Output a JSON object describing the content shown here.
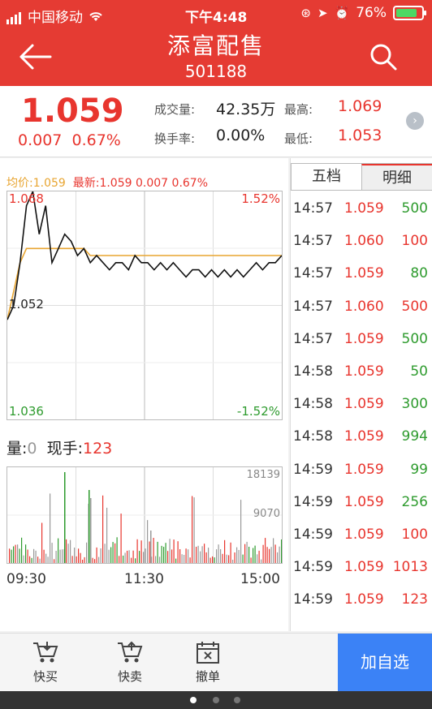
{
  "status": {
    "carrier": "中国移动",
    "time": "下午4:48",
    "battery": "76%"
  },
  "header": {
    "title": "添富配售",
    "code": "501188"
  },
  "quote": {
    "price": "1.059",
    "change": "0.007",
    "change_pct": "0.67%",
    "volume_label": "成交量:",
    "volume": "42.35万",
    "turnover_label": "换手率:",
    "turnover": "0.00%",
    "high_label": "最高:",
    "high": "1.069",
    "low_label": "最低:",
    "low": "1.053"
  },
  "chart_legend": {
    "avg_label": "均价:",
    "avg": "1.059",
    "latest_label": "最新:",
    "latest": "1.059",
    "change": "0.007",
    "change_pct": "0.67%"
  },
  "chart_axes": {
    "top_price": "1.068",
    "top_pct": "1.52%",
    "mid_price": "1.052",
    "bottom_price": "1.036",
    "bottom_pct": "-1.52%",
    "vol_top": "18139",
    "vol_mid": "9070",
    "time_labels": [
      "09:30",
      "11:30",
      "15:00"
    ]
  },
  "volume_row": {
    "label": "量:",
    "value": "0",
    "hand_label": "现手:",
    "hand": "123"
  },
  "tabs": {
    "depth": "五档",
    "detail": "明细"
  },
  "trades": [
    {
      "time": "14:57",
      "price": "1.059",
      "vol": "500",
      "dir": "buy"
    },
    {
      "time": "14:57",
      "price": "1.060",
      "vol": "100",
      "dir": "sell"
    },
    {
      "time": "14:57",
      "price": "1.059",
      "vol": "80",
      "dir": "buy"
    },
    {
      "time": "14:57",
      "price": "1.060",
      "vol": "500",
      "dir": "sell"
    },
    {
      "time": "14:57",
      "price": "1.059",
      "vol": "500",
      "dir": "buy"
    },
    {
      "time": "14:58",
      "price": "1.059",
      "vol": "50",
      "dir": "buy"
    },
    {
      "time": "14:58",
      "price": "1.059",
      "vol": "300",
      "dir": "buy"
    },
    {
      "time": "14:58",
      "price": "1.059",
      "vol": "994",
      "dir": "buy"
    },
    {
      "time": "14:59",
      "price": "1.059",
      "vol": "99",
      "dir": "buy"
    },
    {
      "time": "14:59",
      "price": "1.059",
      "vol": "256",
      "dir": "buy"
    },
    {
      "time": "14:59",
      "price": "1.059",
      "vol": "100",
      "dir": "sell"
    },
    {
      "time": "14:59",
      "price": "1.059",
      "vol": "1013",
      "dir": "sell"
    },
    {
      "time": "14:59",
      "price": "1.059",
      "vol": "123",
      "dir": "sell"
    }
  ],
  "toolbar": {
    "buy": "快买",
    "sell": "快卖",
    "cancel": "撤单",
    "add_fav": "加自选"
  },
  "colors": {
    "header": "#e53b33",
    "up": "#e8352e",
    "down": "#2e9b2e",
    "accent": "#3b82f6",
    "avg_line": "#e8a531"
  },
  "chart_data": {
    "type": "line",
    "price_line": [
      1.05,
      1.052,
      1.058,
      1.066,
      1.068,
      1.062,
      1.066,
      1.058,
      1.06,
      1.062,
      1.061,
      1.059,
      1.06,
      1.058,
      1.059,
      1.058,
      1.057,
      1.058,
      1.058,
      1.057,
      1.059,
      1.058,
      1.058,
      1.057,
      1.058,
      1.057,
      1.058,
      1.057,
      1.056,
      1.057,
      1.057,
      1.056,
      1.057,
      1.056,
      1.057,
      1.056,
      1.057,
      1.056,
      1.057,
      1.058,
      1.057,
      1.058,
      1.058,
      1.059
    ],
    "avg_line": [
      1.05,
      1.054,
      1.058,
      1.06,
      1.06,
      1.06,
      1.06,
      1.06,
      1.06,
      1.06,
      1.06,
      1.06,
      1.06,
      1.059,
      1.059,
      1.059,
      1.059,
      1.059,
      1.059,
      1.059,
      1.059,
      1.059,
      1.059,
      1.059,
      1.059,
      1.059,
      1.059,
      1.059,
      1.059,
      1.059,
      1.059,
      1.059,
      1.059,
      1.059,
      1.059,
      1.059,
      1.059,
      1.059,
      1.059,
      1.059,
      1.059,
      1.059,
      1.059,
      1.059
    ],
    "ylim": [
      1.036,
      1.068
    ],
    "volume_max": 18139
  }
}
